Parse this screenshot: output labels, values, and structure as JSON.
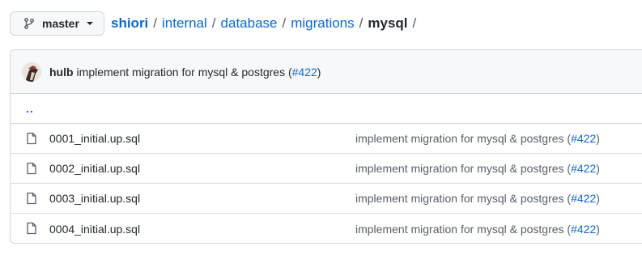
{
  "branch": {
    "label": "master",
    "icon": "git-branch-icon"
  },
  "breadcrumb": {
    "root": "shiori",
    "parts": [
      "internal",
      "database",
      "migrations"
    ],
    "current": "mysql",
    "separator": "/"
  },
  "commit": {
    "author": "hulb",
    "message": "implement migration for mysql & postgres (",
    "pr_link": "#422",
    "message_suffix": ")"
  },
  "updir_label": "..",
  "files": [
    {
      "name": "0001_initial.up.sql",
      "message": "implement migration for mysql & postgres (",
      "pr_link": "#422",
      "suffix": ")"
    },
    {
      "name": "0002_initial.up.sql",
      "message": "implement migration for mysql & postgres (",
      "pr_link": "#422",
      "suffix": ")"
    },
    {
      "name": "0003_initial.up.sql",
      "message": "implement migration for mysql & postgres (",
      "pr_link": "#422",
      "suffix": ")"
    },
    {
      "name": "0004_initial.up.sql",
      "message": "implement migration for mysql & postgres (",
      "pr_link": "#422",
      "suffix": ")"
    }
  ],
  "colors": {
    "link": "#0969da",
    "text": "#24292f",
    "muted": "#57606a",
    "border": "#d0d7de",
    "header_bg": "#f6f8fa"
  }
}
